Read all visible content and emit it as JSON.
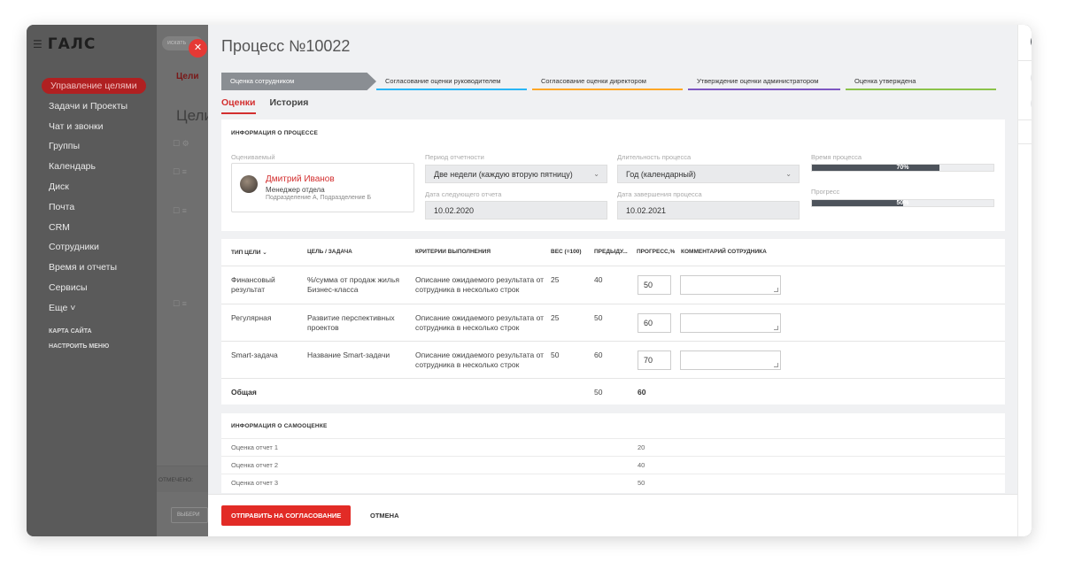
{
  "sidebar": {
    "logo": "ГАЛС",
    "items": [
      {
        "label": "Управление целями",
        "active": true
      },
      {
        "label": "Задачи и Проекты"
      },
      {
        "label": "Чат и звонки"
      },
      {
        "label": "Группы"
      },
      {
        "label": "Календарь"
      },
      {
        "label": "Диск"
      },
      {
        "label": "Почта"
      },
      {
        "label": "CRM"
      },
      {
        "label": "Сотрудники"
      },
      {
        "label": "Время и отчеты"
      },
      {
        "label": "Сервисы"
      },
      {
        "label": "Еще ˅"
      }
    ],
    "links": [
      "КАРТА САЙТА",
      "НАСТРОИТЬ МЕНЮ"
    ]
  },
  "background": {
    "search_placeholder": "искать",
    "tab": "Цели",
    "title": "Цели",
    "bottom_label": "ОТМЕЧЕНО:",
    "bottom_button": "ВЫБЕРИ"
  },
  "panel": {
    "title": "Процесс №10022",
    "steps": [
      {
        "label": "Оценка сотрудником",
        "color": "#8a8e93",
        "done": true
      },
      {
        "label": "Согласование оценки руководителем",
        "color": "#29b6f6"
      },
      {
        "label": "Согласование оценки директором",
        "color": "#ffa726"
      },
      {
        "label": "Утверждение оценки администратором",
        "color": "#7e57c2"
      },
      {
        "label": "Оценка утверждена",
        "color": "#8bc34a"
      }
    ],
    "tabs": [
      {
        "label": "Оценки",
        "active": true
      },
      {
        "label": "История"
      }
    ]
  },
  "process_info": {
    "heading": "ИНФОРМАЦИЯ О ПРОЦЕССЕ",
    "evaluated_label": "Оцениваемый",
    "person": {
      "name": "Дмитрий Иванов",
      "role": "Менеджер отдела",
      "dept": "Подразделение А, Подразделение Б"
    },
    "period_label": "Период отчетности",
    "period_value": "Две недели (каждую вторую пятницу)",
    "next_report_label": "Дата следующего отчета",
    "next_report_value": "10.02.2020",
    "duration_label": "Длительность процесса",
    "duration_value": "Год (календарный)",
    "end_date_label": "Дата завершения процесса",
    "end_date_value": "10.02.2021",
    "time_label": "Время процесса",
    "time_progress": 0.7,
    "time_pct_text": "70%",
    "progress_label": "Прогресс",
    "progress": 0.5,
    "progress_pct_text": "50%"
  },
  "goals": {
    "columns": {
      "type": "ТИП ЦЕЛИ ⌄",
      "goal": "ЦЕЛЬ / ЗАДАЧА",
      "criteria": "КРИТЕРИИ ВЫПОЛНЕНИЯ",
      "weight": "ВЕС (=100)",
      "prev": "ПРЕДЫДУ...",
      "progress": "ПРОГРЕСС,%",
      "comment": "КОММЕНТАРИЙ СОТРУДНИКА"
    },
    "rows": [
      {
        "type": "Финансовый результат",
        "goal": "%/сумма от продаж жилья Бизнес-класса",
        "criteria": "Описание ожидаемого результата от сотрудника в несколько строк",
        "weight": "25",
        "prev": "40",
        "progress": "50"
      },
      {
        "type": "Регулярная",
        "goal": "Развитие перспективных проектов",
        "criteria": "Описание ожидаемого результата от сотрудника в несколько строк",
        "weight": "25",
        "prev": "50",
        "progress": "60"
      },
      {
        "type": "Smart-задача",
        "goal": "Название Smart-задачи",
        "criteria": "Описание ожидаемого результата от сотрудника в несколько строк",
        "weight": "50",
        "prev": "60",
        "progress": "70"
      }
    ],
    "total": {
      "label": "Общая",
      "prev": "50",
      "progress": "60"
    }
  },
  "self_assessment": {
    "heading": "ИНФОРМАЦИЯ О САМООЦЕНКЕ",
    "rows": [
      {
        "label": "Оценка отчет 1",
        "value": "20"
      },
      {
        "label": "Оценка отчет 2",
        "value": "40"
      },
      {
        "label": "Оценка отчет 3",
        "value": "50"
      }
    ]
  },
  "footer": {
    "submit": "ОТПРАВИТЬ НА СОГЛАСОВАНИЕ",
    "cancel": "ОТМЕНА"
  },
  "right_rail": {
    "icons": [
      "help-icon",
      "bell-icon",
      "skype-icon",
      "search-icon"
    ]
  }
}
